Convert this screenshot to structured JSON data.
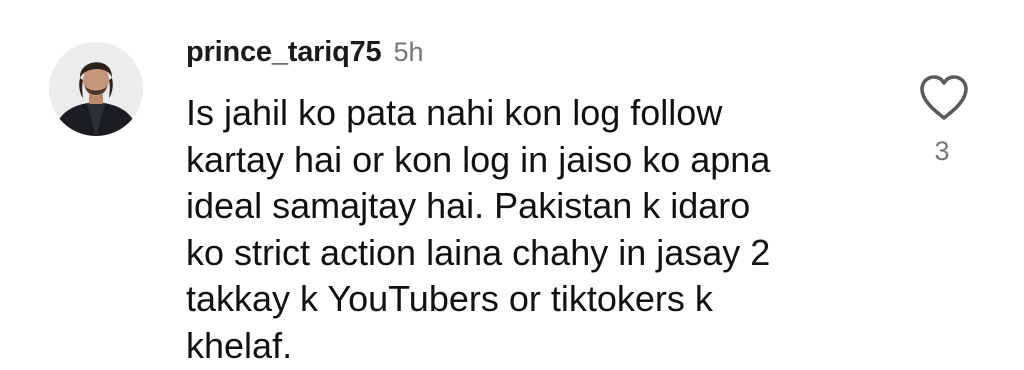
{
  "comment": {
    "username": "prince_tariq75",
    "timestamp": "5h",
    "text": "Is jahil ko pata nahi kon log follow\nkartay hai or kon log in jaiso ko apna\nideal samajtay hai. Pakistan k idaro\nko strict action laina chahy in jasay 2\ntakkay k YouTubers or tiktokers k\nkhelaf.",
    "avatar_icon": "user-avatar-photo",
    "like_icon": "heart-outline-icon",
    "like_count": "3"
  }
}
